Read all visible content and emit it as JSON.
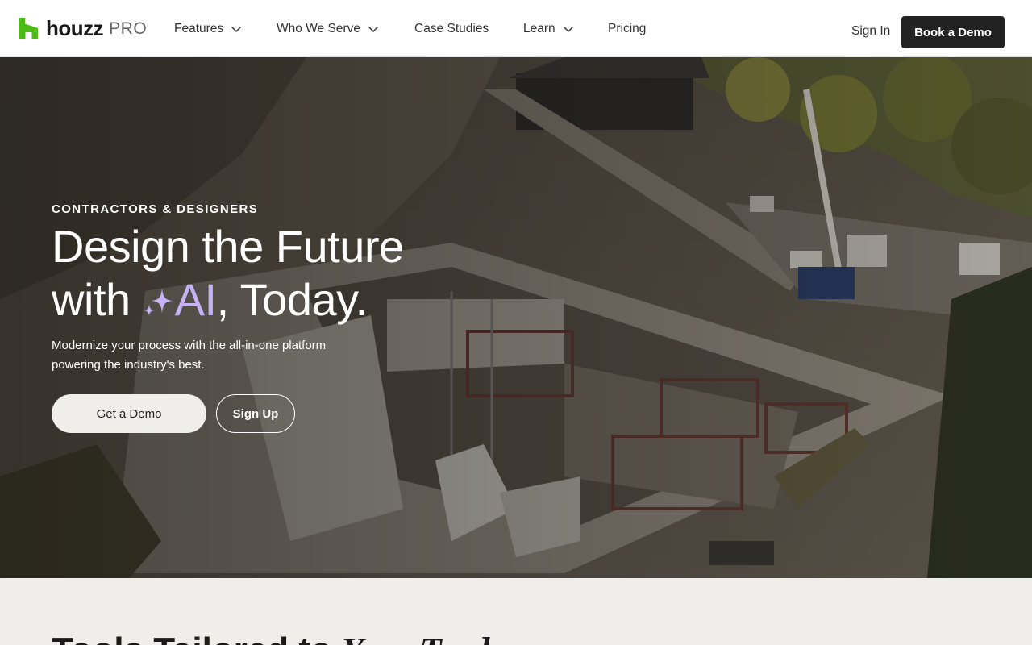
{
  "brand": {
    "name": "houzz",
    "suffix": "PRO",
    "accent": "#4dbc15"
  },
  "nav": {
    "items": [
      {
        "label": "Features",
        "has_dropdown": true
      },
      {
        "label": "Who We Serve",
        "has_dropdown": true
      },
      {
        "label": "Case Studies",
        "has_dropdown": false
      },
      {
        "label": "Learn",
        "has_dropdown": true
      },
      {
        "label": "Pricing",
        "has_dropdown": false
      }
    ],
    "sign_in": "Sign In",
    "cta": "Book a Demo"
  },
  "hero": {
    "eyebrow": "CONTRACTORS & DESIGNERS",
    "headline_line1": "Design the Future",
    "headline_with": "with ",
    "headline_ai": "AI",
    "headline_tail": ", Today.",
    "ai_color": "#c6b2f5",
    "subcopy": "Modernize your process with the all-in-one platform powering the industry's best.",
    "primary_button": "Get a Demo",
    "secondary_button": "Sign Up"
  },
  "section": {
    "title_plain": "Tools Tailored to ",
    "title_italic": "Your Trade"
  }
}
